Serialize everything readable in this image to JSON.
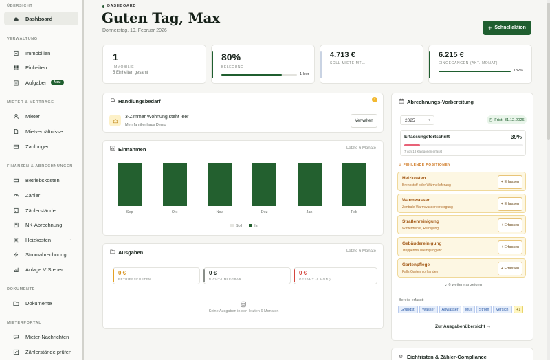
{
  "sidebar": {
    "sections": [
      {
        "label": "ÜBERSICHT",
        "items": [
          {
            "label": "Dashboard",
            "icon": "home-icon",
            "active": true
          }
        ]
      },
      {
        "label": "VERWALTUNG",
        "items": [
          {
            "label": "Immobilien",
            "icon": "building-icon"
          },
          {
            "label": "Einheiten",
            "icon": "grid-icon"
          },
          {
            "label": "Aufgaben",
            "icon": "clipboard-icon",
            "badge": "Neu"
          }
        ]
      },
      {
        "label": "MIETER & VERTRÄGE",
        "items": [
          {
            "label": "Mieter",
            "icon": "user-icon"
          },
          {
            "label": "Mietverhältnisse",
            "icon": "document-icon"
          },
          {
            "label": "Zahlungen",
            "icon": "wallet-icon"
          }
        ]
      },
      {
        "label": "FINANZEN & ABRECHNUNGEN",
        "items": [
          {
            "label": "Betriebskosten",
            "icon": "receipt-icon"
          },
          {
            "label": "Zähler",
            "icon": "gauge-icon"
          },
          {
            "label": "Zählerstände",
            "icon": "meter-icon"
          },
          {
            "label": "NK-Abrechnung",
            "icon": "calculator-icon"
          },
          {
            "label": "Heizkosten",
            "icon": "sun-icon"
          },
          {
            "label": "Stromabrechnung",
            "icon": "lightning-icon"
          },
          {
            "label": "Anlage V Steuer",
            "icon": "chart-icon"
          }
        ]
      },
      {
        "label": "DOKUMENTE",
        "items": [
          {
            "label": "Dokumente",
            "icon": "folder-icon"
          }
        ]
      },
      {
        "label": "MIETERPORTAL",
        "items": [
          {
            "label": "Mieter-Nachrichten",
            "icon": "chat-icon"
          },
          {
            "label": "Zählerstände prüfen",
            "icon": "check-icon"
          }
        ]
      }
    ]
  },
  "header": {
    "kicker": "DASHBOARD",
    "greeting": "Guten Tag, Max",
    "date": "Donnerstag, 19. Februar 2026",
    "quick_action": "Schnellaktion"
  },
  "stats": [
    {
      "value": "1",
      "label": "IMMOBILIE",
      "sub": "5 Einheiten gesamt"
    },
    {
      "value": "80%",
      "label": "BELEGUNG",
      "progress": 0.8,
      "progress_label": "1 leer"
    },
    {
      "value": "4.713 €",
      "label": "SOLL-MIETE MTL."
    },
    {
      "value": "6.215 €",
      "label": "EINGEGANGEN (AKT. MONAT)",
      "progress": 1.0,
      "progress_label": "132%"
    }
  ],
  "handlungsbedarf": {
    "title": "Handlungsbedarf",
    "item_title": "3-Zimmer Wohnung steht leer",
    "item_sub": "Mehrfamilienhaus Demo",
    "action": "Verwalten"
  },
  "einnahmen": {
    "title": "Einnahmen",
    "period": "Letzte 6 Monate",
    "legend_soll": "Soll",
    "legend_ist": "Ist"
  },
  "chart_data": {
    "type": "bar",
    "categories": [
      "Sep",
      "Okt",
      "Nov",
      "Dez",
      "Jan",
      "Feb"
    ],
    "series": [
      {
        "name": "Soll",
        "values": [
          1,
          1,
          1,
          1,
          1,
          1
        ]
      },
      {
        "name": "Ist",
        "values": [
          1,
          1,
          1,
          1,
          1,
          1
        ]
      }
    ],
    "legend": "bottom",
    "grid": false,
    "colors": {
      "Soll": "#e6e6e1",
      "Ist": "#23602f"
    }
  },
  "ausgaben": {
    "title": "Ausgaben",
    "period": "Letzte 6 Monate",
    "boxes": [
      {
        "value": "0 €",
        "label": "BETRIEBSKOSTEN",
        "color": "#e4a126"
      },
      {
        "value": "0 €",
        "label": "NICHT-UMLEGBAR",
        "color": "#8a8f8a"
      },
      {
        "value": "0 €",
        "label": "GESAMT (6 MON.)",
        "color": "#d4463d"
      }
    ],
    "empty": "Keine Ausgaben in den letzten 6 Monaten"
  },
  "abrechnung": {
    "title": "Abrechnungs-Vorbereitung",
    "year": "2025",
    "deadline": "Frist: 31.12.2026",
    "progress_title": "Erfassungsfortschritt",
    "progress_pct": "39%",
    "progress_value": 0.39,
    "progress_sub": "7 von 18 Kategorien erfasst",
    "missing_header": "FEHLENDE POSITIONEN",
    "missing": [
      {
        "name": "Heizkosten",
        "desc": "Brennstoff oder Wärmelieferung",
        "action": "+ Erfassen"
      },
      {
        "name": "Warmwasser",
        "desc": "Zentrale Warmwasserversorgung",
        "action": "+ Erfassen"
      },
      {
        "name": "Straßenreinigung",
        "desc": "Winterdienst, Reinigung",
        "action": "+ Erfassen"
      },
      {
        "name": "Gebäudereinigung",
        "desc": "Treppenhausreinigung etc.",
        "action": "+ Erfassen"
      },
      {
        "name": "Gartenpflege",
        "desc": "Falls Garten vorhanden",
        "action": "+ Erfassen"
      }
    ],
    "more": "6 weitere anzeigen",
    "recorded_label": "Bereits erfasst:",
    "recorded": [
      "Grundst.",
      "Wasser",
      "Abwasser",
      "Müll",
      "Strom",
      "Versich.",
      "+1"
    ],
    "overview_link": "Zur Ausgabenübersicht →"
  },
  "compliance": {
    "title": "Eichfristen & Zähler-Compliance"
  }
}
